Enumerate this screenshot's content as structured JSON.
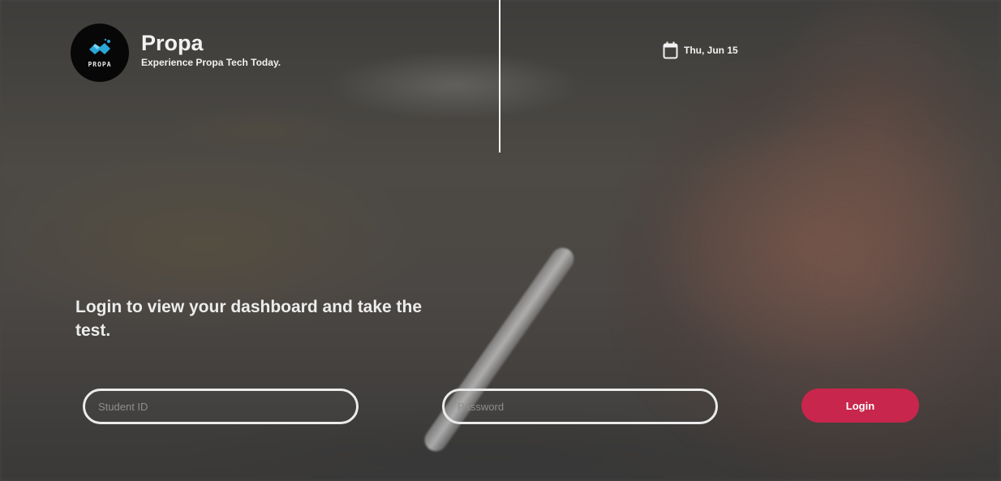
{
  "brand": {
    "logo_text": "PROPA",
    "name": "Propa",
    "tagline": "Experience Propa Tech Today."
  },
  "header": {
    "date": "Thu, Jun 15",
    "date_icon": "calendar-icon"
  },
  "main": {
    "headline": "Login to view your dashboard and take the test."
  },
  "login_form": {
    "student_id_placeholder": "Student ID",
    "password_placeholder": "Password",
    "login_label": "Login"
  },
  "colors": {
    "accent": "#c8264c",
    "logo_blue": "#2ba7d6",
    "text": "#f2f2f2"
  }
}
